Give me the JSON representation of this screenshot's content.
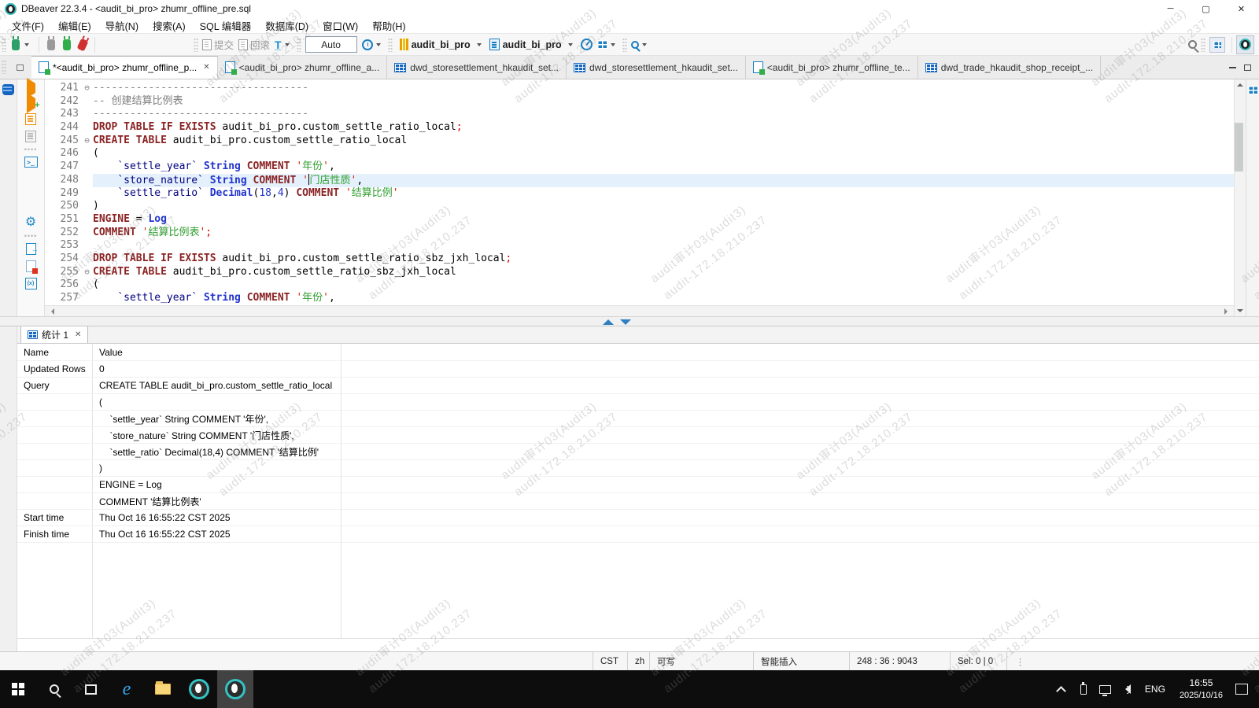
{
  "titlebar": {
    "title": "DBeaver 22.3.4 - <audit_bi_pro> zhumr_offline_pre.sql"
  },
  "menubar": {
    "items": [
      "文件(F)",
      "编辑(E)",
      "导航(N)",
      "搜索(A)",
      "SQL 编辑器",
      "数据库(D)",
      "窗口(W)",
      "帮助(H)"
    ]
  },
  "toolbar": {
    "commit_label": "提交",
    "rollback_label": "回滚",
    "auto_label": "Auto",
    "database": "audit_bi_pro",
    "schema": "audit_bi_pro"
  },
  "tabs": {
    "items": [
      {
        "label": "*<audit_bi_pro> zhumr_offline_p...",
        "type": "sql",
        "active": true,
        "close": true
      },
      {
        "label": "<audit_bi_pro> zhumr_offline_a...",
        "type": "sql"
      },
      {
        "label": "dwd_storesettlement_hkaudit_set...",
        "type": "table"
      },
      {
        "label": "dwd_storesettlement_hkaudit_set...",
        "type": "table"
      },
      {
        "label": "<audit_bi_pro> zhumr_offline_te...",
        "type": "sql"
      },
      {
        "label": "dwd_trade_hkaudit_shop_receipt_...",
        "type": "table"
      }
    ]
  },
  "editor": {
    "lines": [
      {
        "num": "241",
        "fold": true,
        "seg": [
          {
            "c": "cm",
            "t": "-----------------------------------"
          }
        ]
      },
      {
        "num": "242",
        "seg": [
          {
            "c": "cm",
            "t": "-- 创建结算比例表"
          }
        ]
      },
      {
        "num": "243",
        "seg": [
          {
            "c": "cm",
            "t": "-----------------------------------"
          }
        ]
      },
      {
        "num": "244",
        "seg": [
          {
            "c": "kw",
            "t": "DROP TABLE IF EXISTS"
          },
          {
            "c": "pl",
            "t": " audit_bi_pro.custom_settle_ratio_local"
          },
          {
            "c": "d",
            "t": ";"
          }
        ]
      },
      {
        "num": "245",
        "fold": true,
        "seg": [
          {
            "c": "kw",
            "t": "CREATE TABLE"
          },
          {
            "c": "pl",
            "t": " audit_bi_pro.custom_settle_ratio_local"
          }
        ]
      },
      {
        "num": "246",
        "seg": [
          {
            "c": "pl",
            "t": "("
          }
        ]
      },
      {
        "num": "247",
        "seg": [
          {
            "c": "pl",
            "t": "    "
          },
          {
            "c": "id",
            "t": "`settle_year`"
          },
          {
            "c": "pl",
            "t": " "
          },
          {
            "c": "ty",
            "t": "String"
          },
          {
            "c": "pl",
            "t": " "
          },
          {
            "c": "kw",
            "t": "COMMENT"
          },
          {
            "c": "pl",
            "t": " "
          },
          {
            "c": "q",
            "t": "'"
          },
          {
            "c": "s",
            "t": "年份"
          },
          {
            "c": "q",
            "t": "'"
          },
          {
            "c": "pl",
            "t": ","
          }
        ]
      },
      {
        "num": "248",
        "current": true,
        "seg": [
          {
            "c": "pl",
            "t": "    "
          },
          {
            "c": "id",
            "t": "`store_nature`"
          },
          {
            "c": "pl",
            "t": " "
          },
          {
            "c": "ty",
            "t": "String"
          },
          {
            "c": "pl",
            "t": " "
          },
          {
            "c": "kw",
            "t": "COMMENT"
          },
          {
            "c": "pl",
            "t": " "
          },
          {
            "c": "q",
            "t": "'"
          },
          {
            "c": "cursor",
            "t": ""
          },
          {
            "c": "s",
            "t": "门店性质"
          },
          {
            "c": "q",
            "t": "'"
          },
          {
            "c": "pl",
            "t": ","
          }
        ]
      },
      {
        "num": "249",
        "seg": [
          {
            "c": "pl",
            "t": "    "
          },
          {
            "c": "id",
            "t": "`settle_ratio`"
          },
          {
            "c": "pl",
            "t": " "
          },
          {
            "c": "ty",
            "t": "Decimal"
          },
          {
            "c": "pl",
            "t": "("
          },
          {
            "c": "n",
            "t": "18"
          },
          {
            "c": "pl",
            "t": ","
          },
          {
            "c": "n",
            "t": "4"
          },
          {
            "c": "pl",
            "t": ")"
          },
          {
            "c": "pl",
            "t": " "
          },
          {
            "c": "kw",
            "t": "COMMENT"
          },
          {
            "c": "pl",
            "t": " "
          },
          {
            "c": "q",
            "t": "'"
          },
          {
            "c": "s",
            "t": "结算比例"
          },
          {
            "c": "q",
            "t": "'"
          }
        ]
      },
      {
        "num": "250",
        "seg": [
          {
            "c": "pl",
            "t": ")"
          }
        ]
      },
      {
        "num": "251",
        "seg": [
          {
            "c": "kw",
            "t": "ENGINE"
          },
          {
            "c": "pl",
            "t": " = "
          },
          {
            "c": "ty",
            "t": "Log"
          }
        ]
      },
      {
        "num": "252",
        "seg": [
          {
            "c": "kw",
            "t": "COMMENT"
          },
          {
            "c": "pl",
            "t": " "
          },
          {
            "c": "q",
            "t": "'"
          },
          {
            "c": "s",
            "t": "结算比例表"
          },
          {
            "c": "q",
            "t": "'"
          },
          {
            "c": "d",
            "t": ";"
          }
        ]
      },
      {
        "num": "253",
        "seg": []
      },
      {
        "num": "254",
        "seg": [
          {
            "c": "kw",
            "t": "DROP TABLE IF EXISTS"
          },
          {
            "c": "pl",
            "t": " audit_bi_pro.custom_settle_ratio_sbz_jxh_local"
          },
          {
            "c": "d",
            "t": ";"
          }
        ]
      },
      {
        "num": "255",
        "fold": true,
        "seg": [
          {
            "c": "kw",
            "t": "CREATE TABLE"
          },
          {
            "c": "pl",
            "t": " audit_bi_pro.custom_settle_ratio_sbz_jxh_local"
          }
        ]
      },
      {
        "num": "256",
        "seg": [
          {
            "c": "pl",
            "t": "("
          }
        ]
      },
      {
        "num": "257",
        "seg": [
          {
            "c": "pl",
            "t": "    "
          },
          {
            "c": "id",
            "t": "`settle_year`"
          },
          {
            "c": "pl",
            "t": " "
          },
          {
            "c": "ty",
            "t": "String"
          },
          {
            "c": "pl",
            "t": " "
          },
          {
            "c": "kw",
            "t": "COMMENT"
          },
          {
            "c": "pl",
            "t": " "
          },
          {
            "c": "q",
            "t": "'"
          },
          {
            "c": "s",
            "t": "年份"
          },
          {
            "c": "q",
            "t": "'"
          },
          {
            "c": "pl",
            "t": ","
          }
        ]
      }
    ]
  },
  "stats": {
    "tab_label": "统计 1",
    "header": {
      "name": "Name",
      "value": "Value"
    },
    "rows": [
      {
        "name": "Updated Rows",
        "value": "0"
      },
      {
        "name": "Query",
        "value": "CREATE TABLE audit_bi_pro.custom_settle_ratio_local"
      },
      {
        "name": "",
        "value": "("
      },
      {
        "name": "",
        "value": "    `settle_year` String COMMENT '年份',"
      },
      {
        "name": "",
        "value": "    `store_nature` String COMMENT '门店性质',"
      },
      {
        "name": "",
        "value": "    `settle_ratio` Decimal(18,4) COMMENT '结算比例'"
      },
      {
        "name": "",
        "value": ")"
      },
      {
        "name": "",
        "value": "ENGINE = Log"
      },
      {
        "name": "",
        "value": "COMMENT '结算比例表'"
      },
      {
        "name": "Start time",
        "value": "Thu Oct 16 16:55:22 CST 2025"
      },
      {
        "name": "Finish time",
        "value": "Thu Oct 16 16:55:22 CST 2025"
      }
    ]
  },
  "statusbar": {
    "items": [
      "CST",
      "zh",
      "可写",
      "智能插入",
      "248 : 36 : 9043",
      "Sel: 0 | 0"
    ]
  },
  "taskbar": {
    "lang": "ENG",
    "time": "16:55",
    "date": "2025/10/16"
  },
  "watermark": {
    "line1": "audit审计03(Audit3)",
    "line2": "audit-172.18.210.237"
  }
}
